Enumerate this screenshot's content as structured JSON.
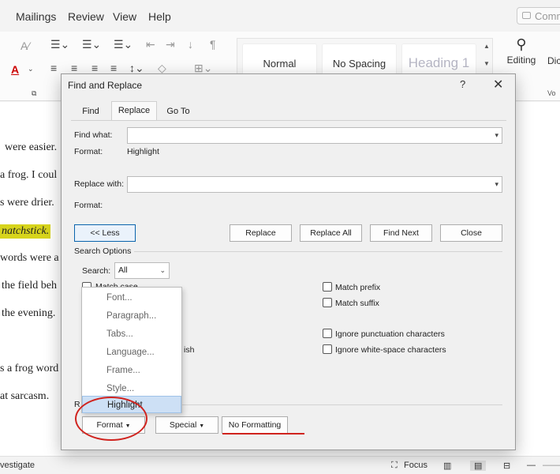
{
  "ribbon": {
    "tabs": [
      "Mailings",
      "Review",
      "View",
      "Help"
    ],
    "comments_label": "Comm",
    "styles": [
      "Normal",
      "No Spacing",
      "Heading 1"
    ],
    "editing_label": "Editing",
    "dictate_label": "Dic",
    "side_label": "Vo"
  },
  "document": {
    "lines": [
      "were easier.",
      "a frog. I coul",
      "s were drier.",
      "natchstick.",
      "words were a",
      "the field beh",
      "the evening.",
      "s a frog word",
      "at sarcasm."
    ]
  },
  "status": {
    "left": "vestigate",
    "focus": "Focus"
  },
  "dialog": {
    "title": "Find and Replace",
    "help": "?",
    "close": "✕",
    "tabs": [
      "Find",
      "Replace",
      "Go To"
    ],
    "find_label": "Find what:",
    "find_value": "",
    "format_label": "Format:",
    "find_format": "Highlight",
    "replace_label": "Replace with:",
    "replace_value": "",
    "replace_format": "",
    "less_button": "<< Less",
    "replace_button": "Replace",
    "replace_all_button": "Replace All",
    "find_next_button": "Find Next",
    "close_button": "Close",
    "search_options_label": "Search Options",
    "search_label": "Search:",
    "search_value": "All",
    "options_left": [
      "Match case"
    ],
    "options_left_partial": [
      "ish"
    ],
    "options_right": [
      "Match prefix",
      "Match suffix",
      "Ignore punctuation characters",
      "Ignore white-space characters"
    ],
    "replace_section_label": "R",
    "format_button": "Format",
    "special_button": "Special",
    "no_formatting_button": "No Formatting"
  },
  "format_menu": {
    "items": [
      "Font...",
      "Paragraph...",
      "Tabs...",
      "Language...",
      "Frame...",
      "Style...",
      "Highlight"
    ],
    "selected": "Highlight"
  },
  "colors": {
    "annotation": "#d0231e",
    "highlight": "#d7d41c",
    "accent": "#0a64ad"
  }
}
